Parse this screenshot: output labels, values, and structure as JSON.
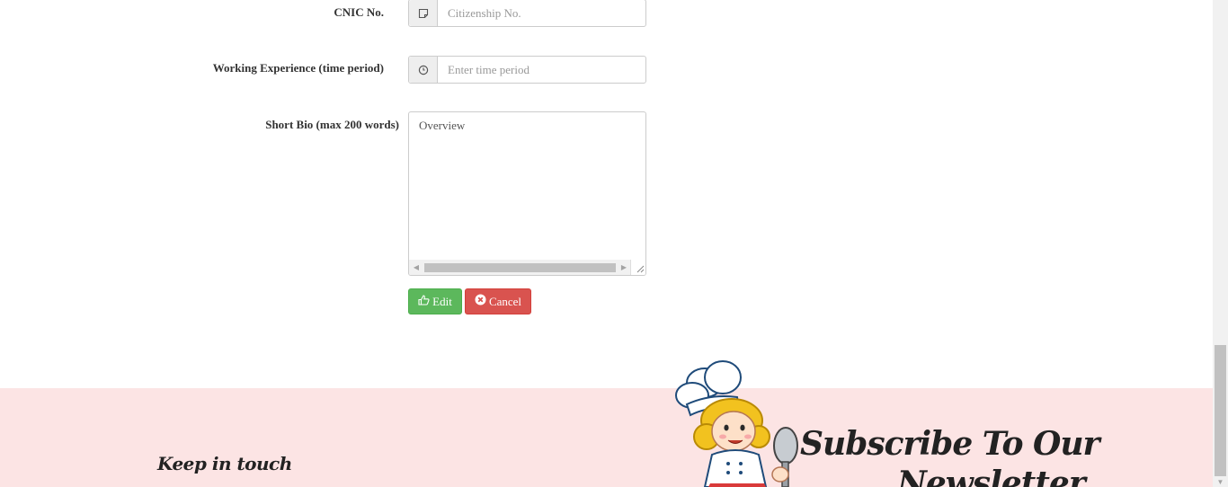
{
  "form": {
    "cnic": {
      "label": "CNIC No.",
      "placeholder": "Citizenship No.",
      "icon": "note-icon"
    },
    "experience": {
      "label": "Working Experience (time period)",
      "placeholder": "Enter time period",
      "icon": "clock-icon"
    },
    "bio": {
      "label": "Short Bio (max 200 words)",
      "value": "Overview"
    },
    "buttons": {
      "edit_label": "Edit",
      "cancel_label": "Cancel"
    }
  },
  "footer": {
    "keep_in_touch": "Keep in touch",
    "subscribe_line1": "Subscribe To Our",
    "subscribe_line2": "Newsletter"
  },
  "colors": {
    "edit_button": "#5cb85c",
    "cancel_button": "#d9534f",
    "footer_background": "#fce4e4"
  }
}
